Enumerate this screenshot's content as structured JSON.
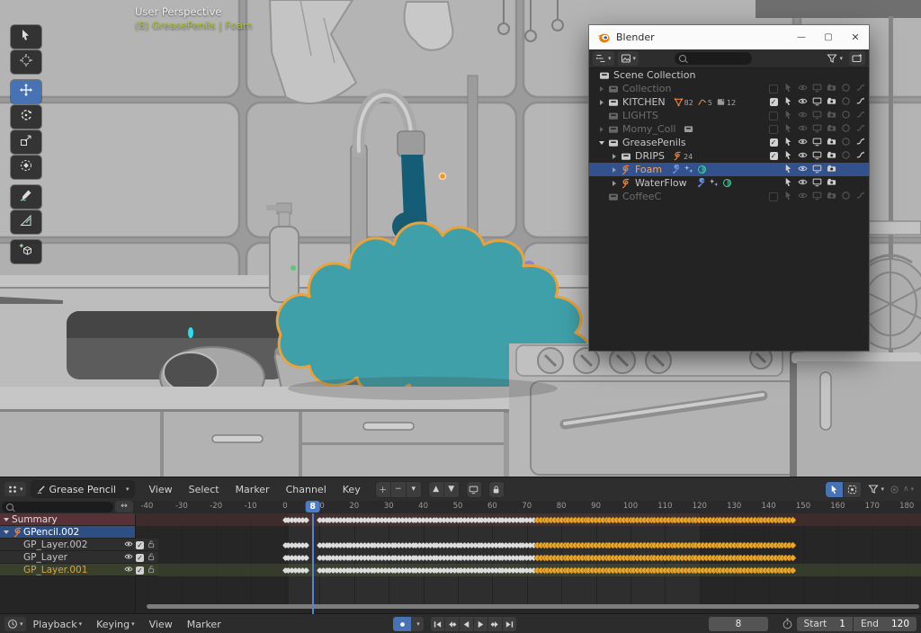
{
  "colors": {
    "accent_blue": "#4772b3",
    "selection_blue": "#33518c",
    "gp_orange": "#e8823c",
    "key_selected": "#eaa72f",
    "key_normal": "#dcdcdc",
    "water_teal": "#155d77",
    "foam_teal": "#3fa0a9",
    "foam_cyan": "#2bdef1",
    "outline_orange": "#e8a33d"
  },
  "viewport": {
    "overlay_line1": "User Perspective",
    "overlay_line2": "(8) GreasePenils | Foam",
    "toolbar_tools": [
      "select",
      "cursor",
      "move",
      "rotate",
      "scale",
      "transform",
      "annotate",
      "measure",
      "add-cube"
    ],
    "active_tool": "move"
  },
  "blender_window": {
    "title": "Blender",
    "minimize_glyph": "—",
    "maximize_glyph": "▢",
    "close_glyph": "✕",
    "outliner": {
      "search_value": "",
      "scene_root": "Scene Collection",
      "rows": [
        {
          "label": "Collection",
          "icon": "collection",
          "dim": true,
          "indent": 0,
          "expander": "right",
          "checkbox": "unchecked",
          "toggles": "full",
          "badges": []
        },
        {
          "label": "KITCHEN",
          "icon": "collection",
          "dim": false,
          "indent": 0,
          "expander": "right",
          "checkbox": "checked",
          "toggles": "full",
          "badges": [
            {
              "icon": "mesh",
              "count": "82"
            },
            {
              "icon": "curve",
              "count": "5"
            },
            {
              "icon": "data",
              "count": "12"
            }
          ]
        },
        {
          "label": "LIGHTS",
          "icon": "collection",
          "dim": true,
          "indent": 0,
          "expander": "none",
          "checkbox": "unchecked",
          "toggles": "full",
          "badges": []
        },
        {
          "label": "Momy_Coll",
          "icon": "collection",
          "dim": true,
          "indent": 0,
          "expander": "right",
          "checkbox": "unchecked",
          "toggles": "full",
          "badges": [
            {
              "icon": "collection",
              "count": ""
            }
          ]
        },
        {
          "label": "GreasePenils",
          "icon": "collection",
          "dim": false,
          "indent": 0,
          "expander": "down",
          "checkbox": "checked",
          "toggles": "full",
          "badges": []
        },
        {
          "label": "DRIPS",
          "icon": "collection",
          "dim": false,
          "indent": 1,
          "expander": "right",
          "checkbox": "checked",
          "toggles": "full",
          "badges": [
            {
              "icon": "gpencil",
              "count": "24"
            }
          ]
        },
        {
          "label": "Foam",
          "icon": "gpencil",
          "dim": false,
          "indent": 1,
          "expander": "right",
          "selected": true,
          "active": true,
          "toggles": "object",
          "badges": [
            {
              "icon": "modifier",
              "count": ""
            },
            {
              "icon": "effect",
              "count": ""
            },
            {
              "icon": "material",
              "count": ""
            }
          ]
        },
        {
          "label": "WaterFlow",
          "icon": "gpencil",
          "dim": false,
          "indent": 1,
          "expander": "right",
          "toggles": "object",
          "badges": [
            {
              "icon": "modifier",
              "count": ""
            },
            {
              "icon": "effect",
              "count": ""
            },
            {
              "icon": "material",
              "count": ""
            }
          ]
        },
        {
          "label": "CoffeeC",
          "icon": "collection",
          "dim": true,
          "indent": 0,
          "expander": "none",
          "checkbox": "unchecked",
          "toggles": "full",
          "badges": []
        }
      ]
    }
  },
  "dopesheet": {
    "editor": "Dope Sheet",
    "mode_label": "Grease Pencil",
    "menus": [
      "View",
      "Select",
      "Marker",
      "Channel",
      "Key"
    ],
    "filter_search_value": "",
    "fit_glyph": "↔",
    "ruler_ticks": [
      -40,
      -30,
      -20,
      -10,
      0,
      10,
      20,
      30,
      40,
      50,
      60,
      70,
      80,
      90,
      100,
      110,
      120,
      130,
      140,
      150,
      160,
      170,
      180
    ],
    "playhead_frame": 8,
    "channels": [
      {
        "label": "Summary",
        "type": "summary"
      },
      {
        "label": "GPencil.002",
        "type": "object"
      },
      {
        "label": "GP_Layer.002",
        "type": "layer"
      },
      {
        "label": "GP_Layer",
        "type": "layer"
      },
      {
        "label": "GP_Layer.001",
        "type": "layer",
        "active": true
      }
    ],
    "keyframes": {
      "first_frame": 0,
      "last_frame": 147,
      "gap_frames": [
        7,
        8,
        9
      ],
      "selected_from_frame": 73,
      "rows_with_keys": [
        0,
        2,
        3,
        4
      ]
    },
    "frame_range_start": 1,
    "frame_range_end": 120
  },
  "timeline": {
    "menus": [
      "Playback",
      "Keying",
      "View",
      "Marker"
    ],
    "current_frame": "8",
    "start_label": "Start",
    "start_value": "1",
    "end_label": "End",
    "end_value": "120"
  }
}
